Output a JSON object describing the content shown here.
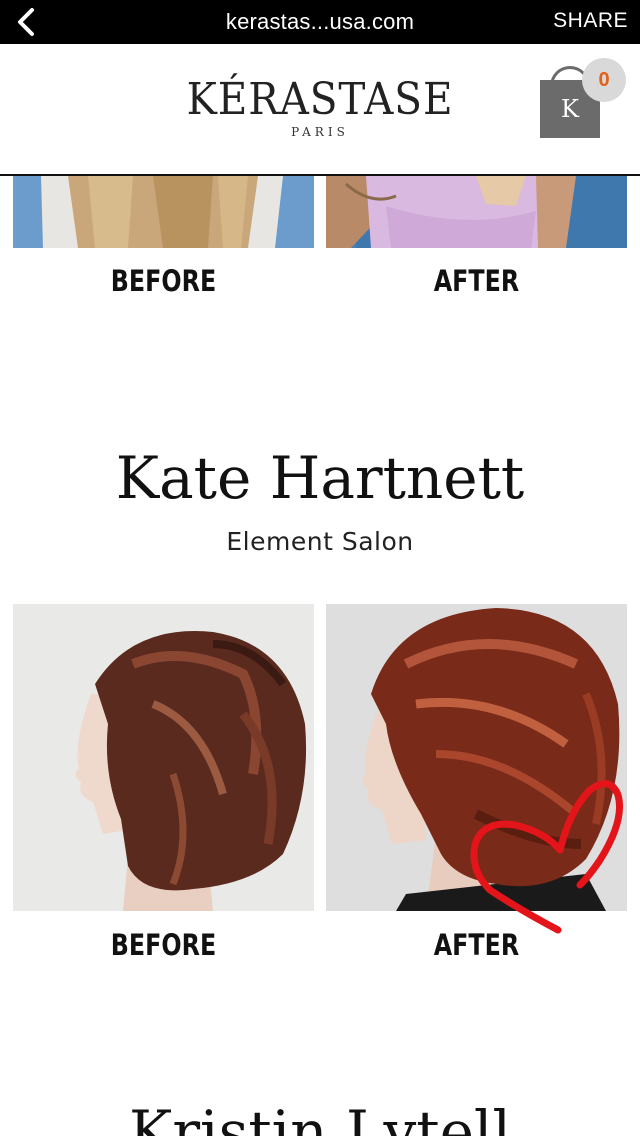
{
  "browser": {
    "url": "kerastas...usa.com",
    "share_label": "SHARE",
    "back_icon": "chevron-left-icon"
  },
  "header": {
    "logo_main": "KÉRASTASE",
    "logo_sub": "PARIS",
    "cart_letter": "K",
    "cart_count": "0",
    "cart_count_color": "#e2621b"
  },
  "gallery_top": {
    "before_label": "BEFORE",
    "after_label": "AFTER"
  },
  "stylist": {
    "name": "Kate Hartnett",
    "salon": "Element Salon",
    "before_label": "BEFORE",
    "after_label": "AFTER",
    "annotation": "red hand-drawn heart"
  },
  "next_stylist": {
    "name": "Kristin Lytell"
  }
}
